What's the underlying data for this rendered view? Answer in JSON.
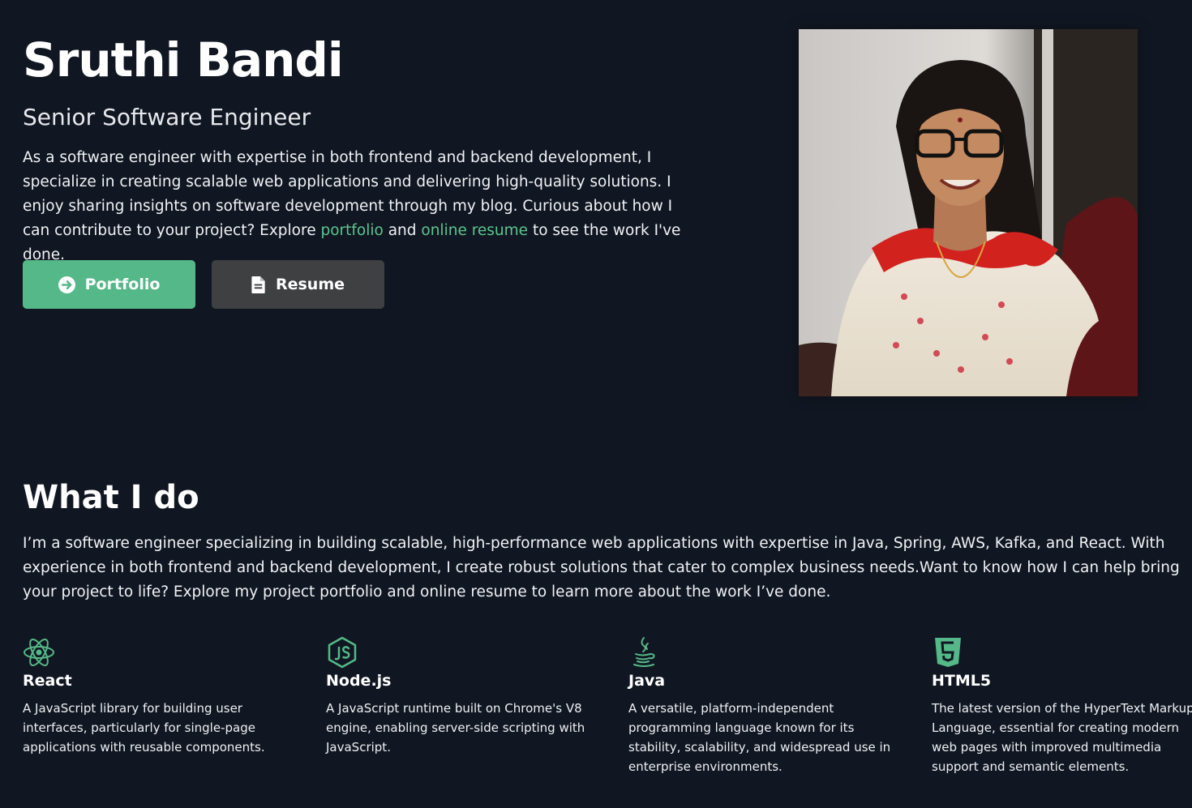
{
  "hero": {
    "name": "Sruthi Bandi",
    "subtitle": "Senior Software Engineer",
    "bio_text": "As a software engineer with expertise in both frontend and backend development, I specialize in creating scalable web applications and delivering high-quality solutions. I enjoy sharing insights on software development through my blog. Curious about how I can contribute to your project? Explore ",
    "bio_link_portfolio": "portfolio",
    "bio_and": " and ",
    "bio_link_resume": "online resume",
    "bio_end": " to see the work I've done.",
    "buttons": {
      "portfolio_label": "Portfolio",
      "resume_label": "Resume"
    }
  },
  "what_i_do": {
    "title": "What I do",
    "intro": "I’m a software engineer specializing in building scalable, high-performance web applications with expertise in Java, Spring, AWS, Kafka, and React. With experience in both frontend and backend development, I create robust solutions that cater to complex business needs.Want to know how I can help bring your project to life? Explore my project portfolio and online resume to learn more about the work I’ve done.",
    "skills": [
      {
        "icon": "react-icon",
        "title": "React",
        "description": "A JavaScript library for building user interfaces, particularly for single-page applications with reusable components."
      },
      {
        "icon": "nodejs-icon",
        "title": "Node.js",
        "description": "A JavaScript runtime built on Chrome's V8 engine, enabling server-side scripting with JavaScript."
      },
      {
        "icon": "java-icon",
        "title": "Java",
        "description": "A versatile, platform-independent programming language known for its stability, scalability, and widespread use in enterprise environments."
      },
      {
        "icon": "html5-icon",
        "title": "HTML5",
        "description": "The latest version of the HyperText Markup Language, essential for creating modern web pages with improved multimedia support and semantic elements."
      }
    ]
  },
  "colors": {
    "background": "#111722",
    "accent": "#55b888",
    "link": "#5bc68e",
    "secondary_button": "#3f4042"
  }
}
